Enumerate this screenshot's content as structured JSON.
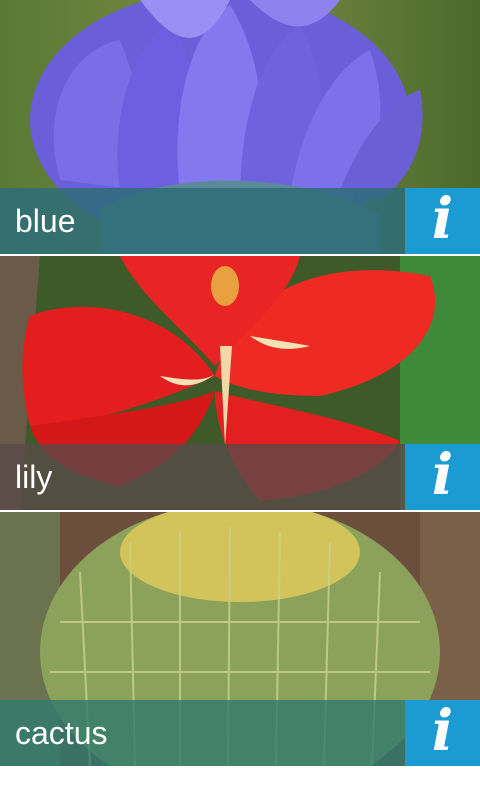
{
  "gallery": {
    "items": [
      {
        "label": "blue",
        "image": "blue-tulip-flower-photo",
        "caption_color": "#2e6c78",
        "info_icon": "info-icon"
      },
      {
        "label": "lily",
        "image": "red-lily-flower-photo",
        "caption_color": "#5a4a4a",
        "info_icon": "info-icon"
      },
      {
        "label": "cactus",
        "image": "barrel-cactus-photo",
        "caption_color": "#2f7a6f",
        "info_icon": "info-icon"
      }
    ],
    "info_glyph": "i",
    "accent": "#1c9ad2"
  }
}
